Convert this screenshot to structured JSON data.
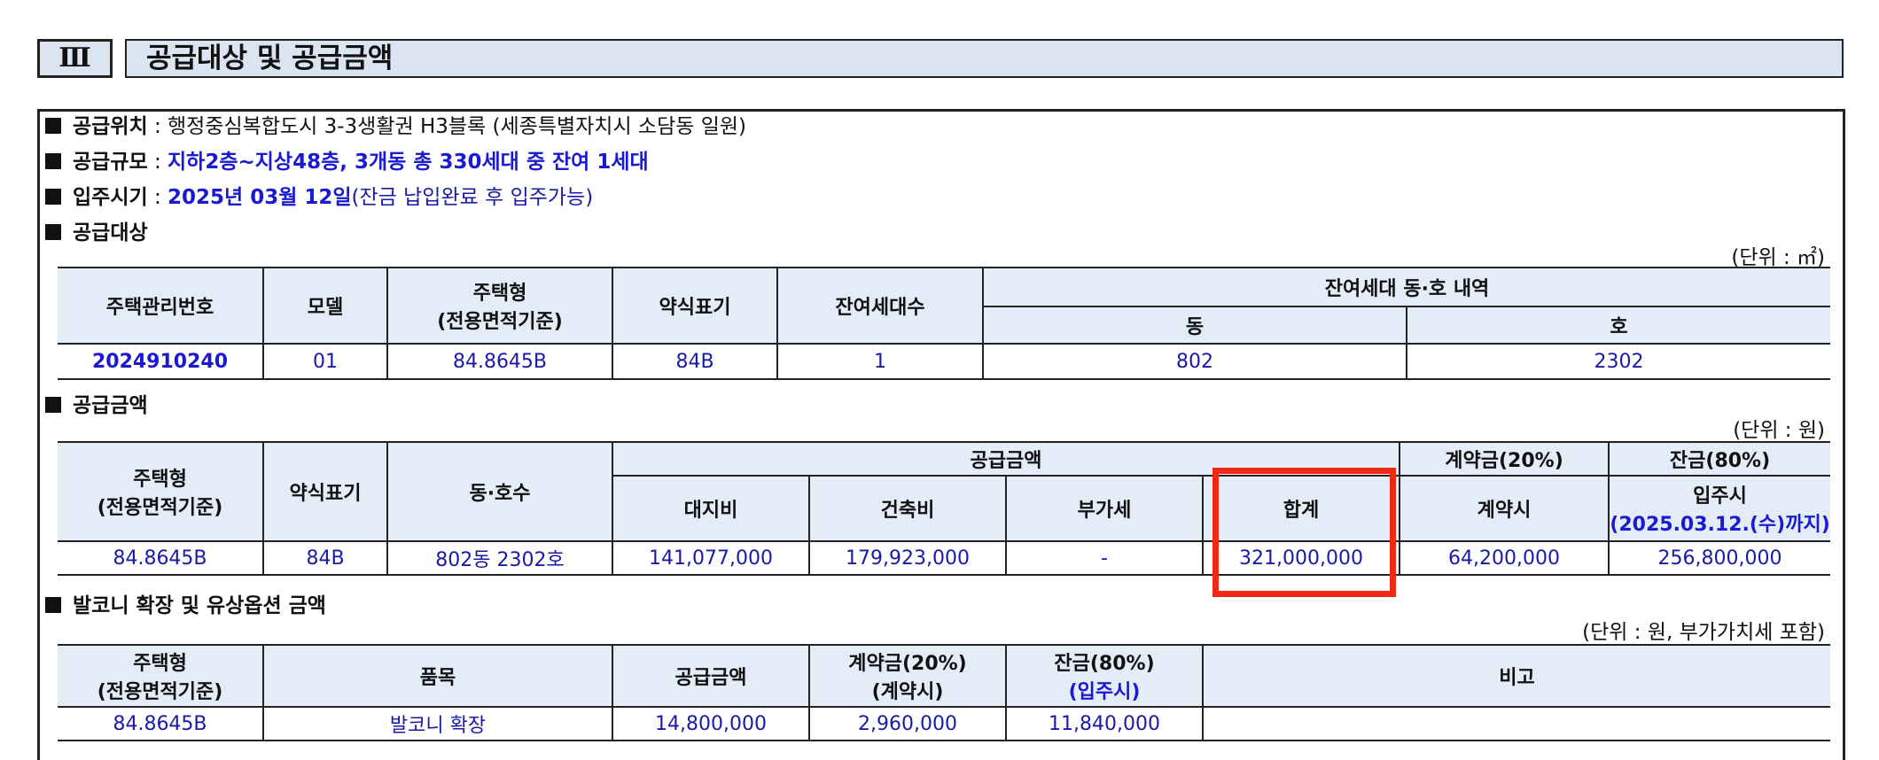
{
  "header": {
    "roman": "Ⅲ",
    "title": "공급대상 및 공급금액"
  },
  "info": {
    "location": {
      "label": "공급위치",
      "sep": " : ",
      "value": "행정중심복합도시 3-3생활권 H3블록 (세종특별자치시 소담동 일원)"
    },
    "scale": {
      "label": "공급규모",
      "sep": " : ",
      "value": "지하2층~지상48층, 3개동 총 330세대 중 잔여 1세대"
    },
    "move_in": {
      "label": "입주시기",
      "sep": " : ",
      "value_bold": "2025년 03월 12일",
      "value_rest": "(잔금 납입완료 후 입주가능)"
    }
  },
  "target": {
    "heading": "공급대상",
    "unit": "(단위 : ㎡)",
    "headers": {
      "mgmt_no": "주택관리번호",
      "model": "모델",
      "type_line1": "주택형",
      "type_line2": "(전용면적기준)",
      "abbr": "약식표기",
      "remaining": "잔여세대수",
      "detail": "잔여세대 동·호 내역",
      "dong": "동",
      "ho": "호"
    },
    "row": {
      "mgmt_no": "2024910240",
      "model": "01",
      "type": "84.8645B",
      "abbr": "84B",
      "remaining": "1",
      "dong": "802",
      "ho": "2302"
    }
  },
  "price": {
    "heading": "공급금액",
    "unit": "(단위 : 원)",
    "headers": {
      "type_line1": "주택형",
      "type_line2": "(전용면적기준)",
      "abbr": "약식표기",
      "unitno": "동·호수",
      "supply": "공급금액",
      "land": "대지비",
      "building": "건축비",
      "vat": "부가세",
      "total": "합계",
      "deposit": "계약금(20%)",
      "deposit_sub": "계약시",
      "balance": "잔금(80%)",
      "balance_sub1": "입주시",
      "balance_sub2": "(2025.03.12.(수)까지)"
    },
    "row": {
      "type": "84.8645B",
      "abbr": "84B",
      "unitno": "802동 2302호",
      "land": "141,077,000",
      "building": "179,923,000",
      "vat": "-",
      "total": "321,000,000",
      "deposit": "64,200,000",
      "balance": "256,800,000"
    }
  },
  "balcony": {
    "heading": "발코니 확장 및 유상옵션 금액",
    "unit": "(단위 : 원, 부가가치세 포함)",
    "headers": {
      "type_line1": "주택형",
      "type_line2": "(전용면적기준)",
      "item": "품목",
      "supply": "공급금액",
      "deposit_line1": "계약금(20%)",
      "deposit_line2": "(계약시)",
      "balance_line1": "잔금(80%)",
      "balance_line2": "(입주시)",
      "note": "비고"
    },
    "row": {
      "type": "84.8645B",
      "item": "발코니 확장",
      "supply": "14,800,000",
      "deposit": "2,960,000",
      "balance": "11,840,000",
      "note": ""
    }
  },
  "highlight": {
    "color": "#ee2a14",
    "target": "price.total"
  }
}
